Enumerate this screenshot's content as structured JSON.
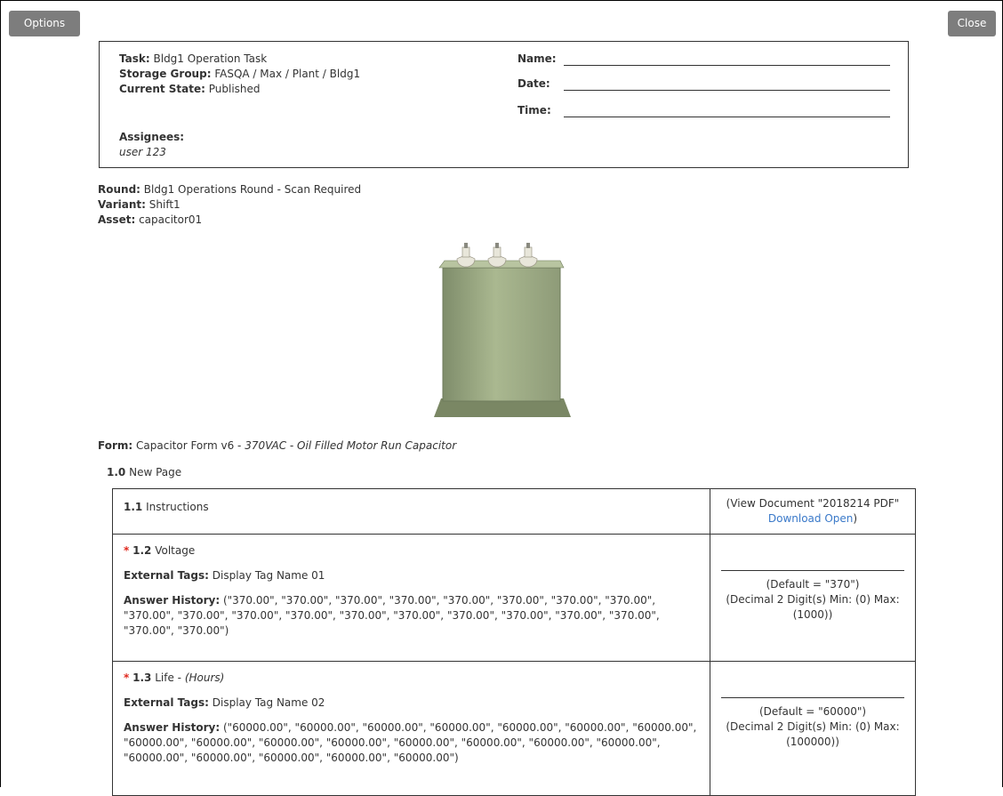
{
  "toolbar": {
    "options_label": "Options",
    "close_label": "Close"
  },
  "header": {
    "task_label": "Task:",
    "task_value": "Bldg1 Operation Task",
    "storage_label": "Storage Group:",
    "storage_value": "FASQA / Max / Plant / Bldg1",
    "state_label": "Current State:",
    "state_value": "Published",
    "assignees_label": "Assignees:",
    "assignee_value": "user 123",
    "name_label": "Name:",
    "date_label": "Date:",
    "time_label": "Time:"
  },
  "meta": {
    "round_label": "Round:",
    "round_value": "Bldg1 Operations Round - Scan Required",
    "variant_label": "Variant:",
    "variant_value": "Shift1",
    "asset_label": "Asset:",
    "asset_value": "capacitor01"
  },
  "form": {
    "label": "Form:",
    "name": "Capacitor Form v6",
    "sep": " - ",
    "description": "370VAC - Oil Filled Motor Run Capacitor"
  },
  "page": {
    "number": "1.0",
    "title": "New Page"
  },
  "questions": [
    {
      "number": "1.1",
      "title": "Instructions",
      "doc_prefix": "(View Document \"2018214 PDF\"",
      "download_label": "Download",
      "open_label": "Open",
      "doc_suffix": ")"
    },
    {
      "required": "*",
      "number": "1.2",
      "title": "Voltage",
      "tags_label": "External Tags:",
      "tags_value": "Display Tag Name 01",
      "history_label": "Answer History:",
      "history_value": "(\"370.00\", \"370.00\", \"370.00\", \"370.00\", \"370.00\", \"370.00\", \"370.00\", \"370.00\", \"370.00\", \"370.00\", \"370.00\", \"370.00\", \"370.00\", \"370.00\", \"370.00\", \"370.00\", \"370.00\", \"370.00\", \"370.00\", \"370.00\")",
      "default_text": "(Default = \"370\")",
      "constraints": "(Decimal 2 Digit(s) Min: (0) Max: (1000))"
    },
    {
      "required": "*",
      "number": "1.3",
      "title": "Life",
      "title_sep": " - ",
      "unit": "(Hours)",
      "tags_label": "External Tags:",
      "tags_value": "Display Tag Name 02",
      "history_label": "Answer History:",
      "history_value": "(\"60000.00\", \"60000.00\", \"60000.00\", \"60000.00\", \"60000.00\", \"60000.00\", \"60000.00\", \"60000.00\", \"60000.00\", \"60000.00\", \"60000.00\", \"60000.00\", \"60000.00\", \"60000.00\", \"60000.00\", \"60000.00\", \"60000.00\", \"60000.00\", \"60000.00\", \"60000.00\")",
      "default_text": "(Default = \"60000\")",
      "constraints": "(Decimal 2 Digit(s) Min: (0) Max: (100000))"
    }
  ],
  "colors": {
    "button_bg": "#7d7d7d",
    "required": "#e0281e",
    "link": "#3a79c9"
  }
}
